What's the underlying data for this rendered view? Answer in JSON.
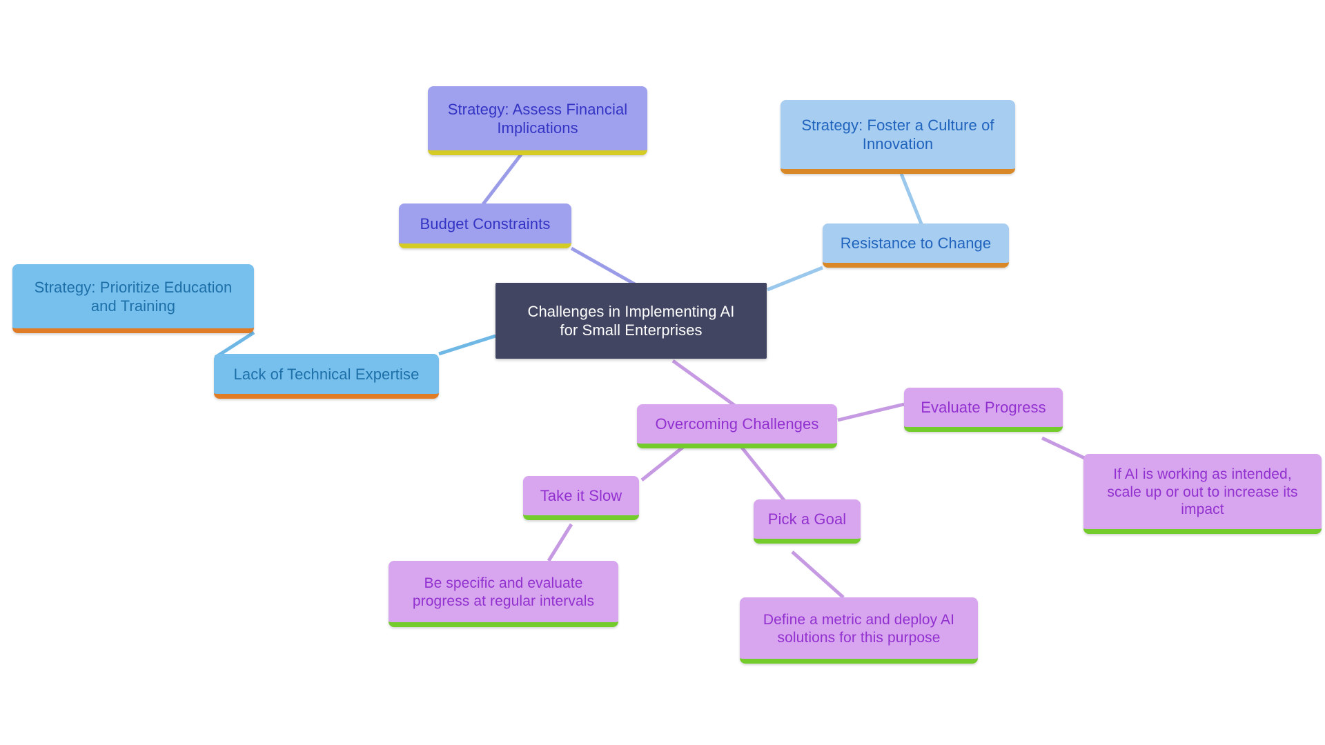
{
  "diagram": {
    "type": "mind-map",
    "title": "Challenges in Implementing AI for Small Enterprises",
    "background": "#ffffff",
    "palette": {
      "root_fill": "#414561",
      "root_text": "#ffffff",
      "periwinkle_fill": "#a0a1ee",
      "periwinkle_text": "#3333c4",
      "periwinkle_underline": "#d4cb24",
      "paleblue_fill": "#a7cdf1",
      "paleblue_text": "#1f63bd",
      "paleblue_underline": "#d98827",
      "skyblue_fill": "#77c0ee",
      "skyblue_text": "#1d6fa8",
      "skyblue_underline": "#e07b26",
      "orchid_fill": "#d7a6ef",
      "orchid_text": "#9230cf",
      "orchid_underline": "#74cc2c",
      "edge_periwinkle": "#9b9ce8",
      "edge_paleblue": "#9ac7ec",
      "edge_skyblue": "#6fb8e6",
      "edge_orchid": "#c69ae2"
    },
    "nodes": {
      "root": "Challenges in Implementing AI\nfor Small Enterprises",
      "budget_constraints": "Budget Constraints",
      "assess_financial": "Strategy: Assess Financial\nImplications",
      "resistance_to_change": "Resistance to Change",
      "foster_innovation": "Strategy: Foster a Culture of\nInnovation",
      "lack_expertise": "Lack of Technical Expertise",
      "prioritize_education": "Strategy: Prioritize Education\nand Training",
      "overcoming_challenges": "Overcoming Challenges",
      "evaluate_progress": "Evaluate Progress",
      "scale_up": "If AI is working as intended,\nscale up or out to increase its\nimpact",
      "take_it_slow": "Take it Slow",
      "be_specific": "Be specific and evaluate\nprogress at regular intervals",
      "pick_a_goal": "Pick a Goal",
      "define_metric": "Define a metric and deploy AI\nsolutions for this purpose"
    },
    "edges": [
      {
        "from": "budget_constraints",
        "to": "root",
        "color": "#9b9ce8"
      },
      {
        "from": "assess_financial",
        "to": "budget_constraints",
        "color": "#9b9ce8"
      },
      {
        "from": "resistance_to_change",
        "to": "root",
        "color": "#9ac7ec"
      },
      {
        "from": "foster_innovation",
        "to": "resistance_to_change",
        "color": "#9ac7ec"
      },
      {
        "from": "lack_expertise",
        "to": "root",
        "color": "#6fb8e6"
      },
      {
        "from": "prioritize_education",
        "to": "lack_expertise",
        "color": "#6fb8e6"
      },
      {
        "from": "overcoming_challenges",
        "to": "root",
        "color": "#c69ae2"
      },
      {
        "from": "evaluate_progress",
        "to": "overcoming_challenges",
        "color": "#c69ae2"
      },
      {
        "from": "scale_up",
        "to": "evaluate_progress",
        "color": "#c69ae2"
      },
      {
        "from": "take_it_slow",
        "to": "overcoming_challenges",
        "color": "#c69ae2"
      },
      {
        "from": "be_specific",
        "to": "take_it_slow",
        "color": "#c69ae2"
      },
      {
        "from": "pick_a_goal",
        "to": "overcoming_challenges",
        "color": "#c69ae2"
      },
      {
        "from": "define_metric",
        "to": "pick_a_goal",
        "color": "#c69ae2"
      }
    ]
  }
}
